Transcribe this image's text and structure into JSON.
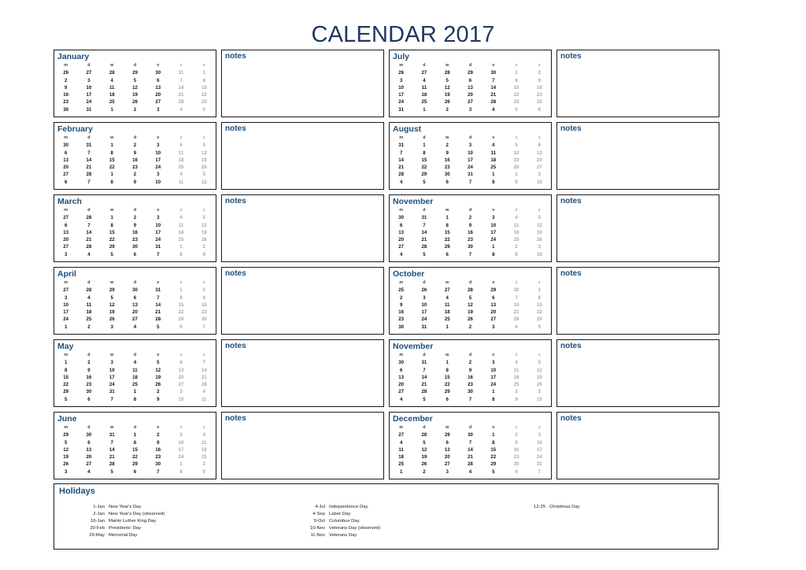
{
  "title": "CALENDAR 2017",
  "colors": {
    "title": "#1F3864",
    "heading": "#1F4E79",
    "weekday": "#3a3a3a",
    "weekend": "#a6a6a6",
    "border": "#1a1a1a",
    "background": "#ffffff"
  },
  "notes_label": "notes",
  "weekdays": [
    "m",
    "d",
    "w",
    "d",
    "v",
    "z",
    "z"
  ],
  "weekend_columns": [
    5,
    6
  ],
  "months": [
    {
      "name": "January",
      "weeks": [
        [
          "26",
          "27",
          "28",
          "29",
          "30",
          "31",
          "1"
        ],
        [
          "2",
          "3",
          "4",
          "5",
          "6",
          "7",
          "8"
        ],
        [
          "9",
          "10",
          "11",
          "12",
          "13",
          "14",
          "15"
        ],
        [
          "16",
          "17",
          "18",
          "19",
          "20",
          "21",
          "22"
        ],
        [
          "23",
          "24",
          "25",
          "26",
          "27",
          "28",
          "29"
        ],
        [
          "30",
          "31",
          "1",
          "2",
          "3",
          "4",
          "5"
        ]
      ]
    },
    {
      "name": "February",
      "weeks": [
        [
          "30",
          "31",
          "1",
          "2",
          "3",
          "4",
          "5"
        ],
        [
          "6",
          "7",
          "8",
          "9",
          "10",
          "11",
          "12"
        ],
        [
          "13",
          "14",
          "15",
          "16",
          "17",
          "18",
          "19"
        ],
        [
          "20",
          "21",
          "22",
          "23",
          "24",
          "25",
          "26"
        ],
        [
          "27",
          "28",
          "1",
          "2",
          "3",
          "4",
          "5"
        ],
        [
          "6",
          "7",
          "8",
          "9",
          "10",
          "11",
          "12"
        ]
      ]
    },
    {
      "name": "March",
      "weeks": [
        [
          "27",
          "28",
          "1",
          "2",
          "3",
          "4",
          "5"
        ],
        [
          "6",
          "7",
          "8",
          "9",
          "10",
          "11",
          "12"
        ],
        [
          "13",
          "14",
          "15",
          "16",
          "17",
          "18",
          "19"
        ],
        [
          "20",
          "21",
          "22",
          "23",
          "24",
          "25",
          "26"
        ],
        [
          "27",
          "28",
          "29",
          "30",
          "31",
          "1",
          "2"
        ],
        [
          "3",
          "4",
          "5",
          "6",
          "7",
          "8",
          "9"
        ]
      ]
    },
    {
      "name": "April",
      "weeks": [
        [
          "27",
          "28",
          "29",
          "30",
          "31",
          "1",
          "2"
        ],
        [
          "3",
          "4",
          "5",
          "6",
          "7",
          "8",
          "9"
        ],
        [
          "10",
          "11",
          "12",
          "13",
          "14",
          "15",
          "16"
        ],
        [
          "17",
          "18",
          "19",
          "20",
          "21",
          "22",
          "23"
        ],
        [
          "24",
          "25",
          "26",
          "27",
          "28",
          "29",
          "30"
        ],
        [
          "1",
          "2",
          "3",
          "4",
          "5",
          "6",
          "7"
        ]
      ]
    },
    {
      "name": "May",
      "weeks": [
        [
          "1",
          "2",
          "3",
          "4",
          "5",
          "6",
          "7"
        ],
        [
          "8",
          "9",
          "10",
          "11",
          "12",
          "13",
          "14"
        ],
        [
          "15",
          "16",
          "17",
          "18",
          "19",
          "20",
          "21"
        ],
        [
          "22",
          "23",
          "24",
          "25",
          "26",
          "27",
          "28"
        ],
        [
          "29",
          "30",
          "31",
          "1",
          "2",
          "3",
          "4"
        ],
        [
          "5",
          "6",
          "7",
          "8",
          "9",
          "10",
          "11"
        ]
      ]
    },
    {
      "name": "June",
      "weeks": [
        [
          "29",
          "30",
          "31",
          "1",
          "2",
          "3",
          "4"
        ],
        [
          "5",
          "6",
          "7",
          "8",
          "9",
          "10",
          "11"
        ],
        [
          "12",
          "13",
          "14",
          "15",
          "16",
          "17",
          "18"
        ],
        [
          "19",
          "20",
          "21",
          "22",
          "23",
          "24",
          "25"
        ],
        [
          "26",
          "27",
          "28",
          "29",
          "30",
          "1",
          "2"
        ],
        [
          "3",
          "4",
          "5",
          "6",
          "7",
          "8",
          "9"
        ]
      ]
    },
    {
      "name": "July",
      "weeks": [
        [
          "26",
          "27",
          "28",
          "29",
          "30",
          "1",
          "2"
        ],
        [
          "3",
          "4",
          "5",
          "6",
          "7",
          "8",
          "9"
        ],
        [
          "10",
          "11",
          "12",
          "13",
          "14",
          "15",
          "16"
        ],
        [
          "17",
          "18",
          "19",
          "20",
          "21",
          "22",
          "23"
        ],
        [
          "24",
          "25",
          "26",
          "27",
          "28",
          "29",
          "30"
        ],
        [
          "31",
          "1",
          "2",
          "3",
          "4",
          "5",
          "6"
        ]
      ]
    },
    {
      "name": "August",
      "weeks": [
        [
          "31",
          "1",
          "2",
          "3",
          "4",
          "5",
          "6"
        ],
        [
          "7",
          "8",
          "9",
          "10",
          "11",
          "12",
          "13"
        ],
        [
          "14",
          "15",
          "16",
          "17",
          "18",
          "19",
          "20"
        ],
        [
          "21",
          "22",
          "23",
          "24",
          "25",
          "26",
          "27"
        ],
        [
          "28",
          "29",
          "30",
          "31",
          "1",
          "2",
          "3"
        ],
        [
          "4",
          "5",
          "6",
          "7",
          "8",
          "9",
          "10"
        ]
      ]
    },
    {
      "name": "November",
      "weeks": [
        [
          "30",
          "31",
          "1",
          "2",
          "3",
          "4",
          "5"
        ],
        [
          "6",
          "7",
          "8",
          "9",
          "10",
          "11",
          "12"
        ],
        [
          "13",
          "14",
          "15",
          "16",
          "17",
          "18",
          "19"
        ],
        [
          "20",
          "21",
          "22",
          "23",
          "24",
          "25",
          "26"
        ],
        [
          "27",
          "28",
          "29",
          "30",
          "1",
          "2",
          "3"
        ],
        [
          "4",
          "5",
          "6",
          "7",
          "8",
          "9",
          "10"
        ]
      ]
    },
    {
      "name": "October",
      "weeks": [
        [
          "25",
          "26",
          "27",
          "28",
          "29",
          "30",
          "1"
        ],
        [
          "2",
          "3",
          "4",
          "5",
          "6",
          "7",
          "8"
        ],
        [
          "9",
          "10",
          "11",
          "12",
          "13",
          "14",
          "15"
        ],
        [
          "16",
          "17",
          "18",
          "19",
          "20",
          "21",
          "22"
        ],
        [
          "23",
          "24",
          "25",
          "26",
          "27",
          "28",
          "29"
        ],
        [
          "30",
          "31",
          "1",
          "2",
          "3",
          "4",
          "5"
        ]
      ]
    },
    {
      "name": "November",
      "weeks": [
        [
          "30",
          "31",
          "1",
          "2",
          "3",
          "4",
          "5"
        ],
        [
          "6",
          "7",
          "8",
          "9",
          "10",
          "11",
          "12"
        ],
        [
          "13",
          "14",
          "15",
          "16",
          "17",
          "18",
          "19"
        ],
        [
          "20",
          "21",
          "22",
          "23",
          "24",
          "25",
          "26"
        ],
        [
          "27",
          "28",
          "29",
          "30",
          "1",
          "2",
          "3"
        ],
        [
          "4",
          "5",
          "6",
          "7",
          "8",
          "9",
          "10"
        ]
      ]
    },
    {
      "name": "December",
      "weeks": [
        [
          "27",
          "28",
          "29",
          "30",
          "1",
          "2",
          "3"
        ],
        [
          "4",
          "5",
          "6",
          "7",
          "8",
          "9",
          "10"
        ],
        [
          "11",
          "12",
          "13",
          "14",
          "15",
          "16",
          "17"
        ],
        [
          "18",
          "19",
          "20",
          "21",
          "22",
          "23",
          "24"
        ],
        [
          "25",
          "26",
          "27",
          "28",
          "29",
          "30",
          "31"
        ],
        [
          "1",
          "2",
          "3",
          "4",
          "5",
          "6",
          "7"
        ]
      ]
    }
  ],
  "holidays": {
    "title": "Holidays",
    "columns": [
      [
        {
          "date": "1-Jan",
          "name": "New Year's Day"
        },
        {
          "date": "2-Jan",
          "name": "New Year's Day (observed)"
        },
        {
          "date": "16-Jan",
          "name": "Martin Luther King Day"
        },
        {
          "date": "20-Feb",
          "name": "Presidents' Day"
        },
        {
          "date": "29-May",
          "name": "Memorial Day"
        }
      ],
      [
        {
          "date": "4-Jul",
          "name": "Independence Day"
        },
        {
          "date": "4-Sep",
          "name": "Labor Day"
        },
        {
          "date": "9-Oct",
          "name": "Columbus Day"
        },
        {
          "date": "10-Nov",
          "name": "Veterans Day (observed)"
        },
        {
          "date": "11-Nov",
          "name": "Veterans Day"
        }
      ],
      [
        {
          "date": "12-25",
          "name": "Christmas Day"
        }
      ]
    ]
  }
}
